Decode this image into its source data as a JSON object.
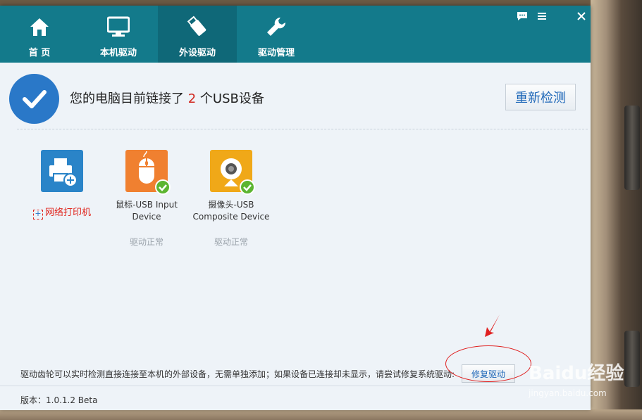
{
  "nav": {
    "items": [
      {
        "label": "首 页",
        "icon": "home-icon"
      },
      {
        "label": "本机驱动",
        "icon": "monitor-icon"
      },
      {
        "label": "外设驱动",
        "icon": "usb-drive-icon",
        "active": true
      },
      {
        "label": "驱动管理",
        "icon": "wrench-icon"
      }
    ]
  },
  "window_controls": [
    "feedback-icon",
    "menu-icon",
    "close-icon"
  ],
  "status": {
    "prefix": "您的电脑目前链接了",
    "count": "2",
    "suffix": "个USB设备",
    "recheck_label": "重新检测"
  },
  "devices": [
    {
      "name": "网络打印机",
      "icon": "printer-icon",
      "add": true
    },
    {
      "name_line1": "鼠标-USB Input",
      "name_line2": "Device",
      "status": "驱动正常",
      "icon": "mouse-icon"
    },
    {
      "name_line1": "摄像头-USB",
      "name_line2": "Composite Device",
      "status": "驱动正常",
      "icon": "webcam-icon"
    }
  ],
  "footer": {
    "note": "驱动齿轮可以实时检测直接连接至本机的外部设备，无需单独添加；如果设备已连接却未显示，请尝试修复系统驱动:",
    "repair_label": "修复驱动",
    "version": "版本：1.0.1.2 Beta"
  },
  "watermark": {
    "brand": "Baidu经验",
    "url": "jingyan.baidu.com"
  },
  "colors": {
    "titlebar": "#137a8b",
    "active_tab": "#0f6878",
    "check_circle": "#2a78c8",
    "count_highlight": "#d1261e",
    "printer_tile": "#2a84c8",
    "mouse_tile": "#f08030",
    "webcam_tile": "#f0a818",
    "ok_badge": "#5cb531"
  }
}
